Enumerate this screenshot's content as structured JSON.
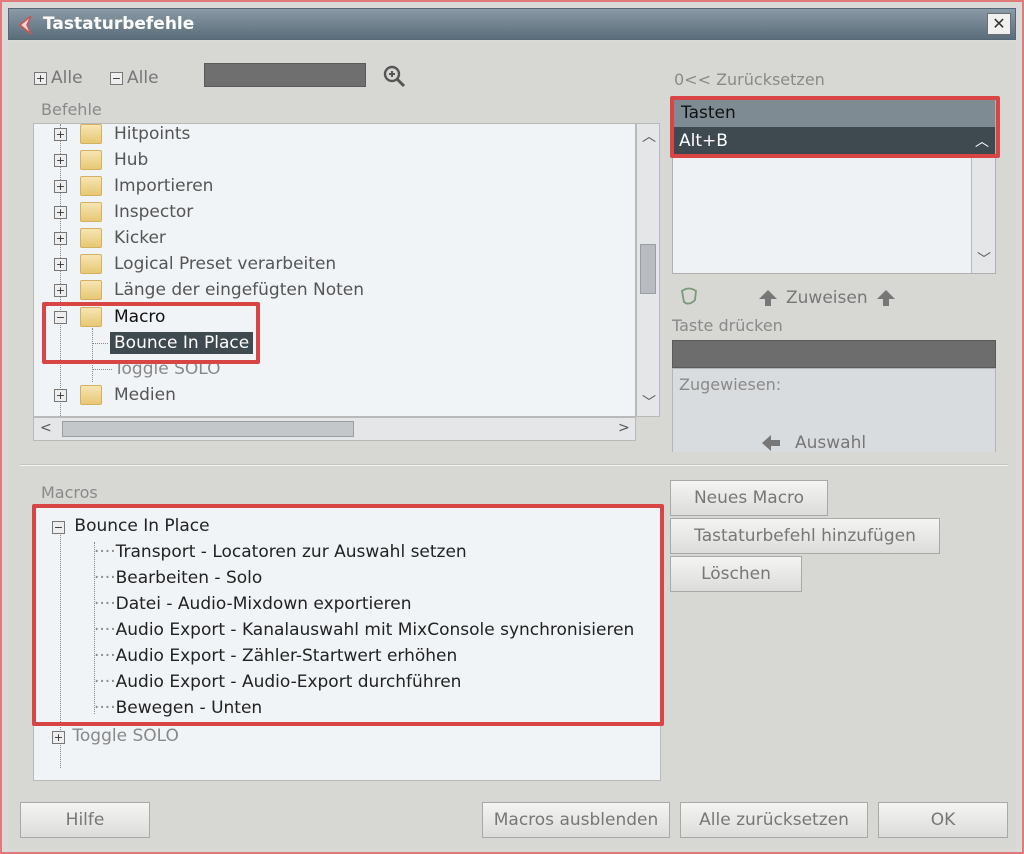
{
  "window": {
    "title": "Tastaturbefehle",
    "close_symbol": "✕"
  },
  "toolbar": {
    "expand_all": "Alle",
    "collapse_all": "Alle",
    "search_value": ""
  },
  "commands": {
    "label": "Befehle",
    "items": [
      {
        "label": "Hitpoints",
        "state": "collapsed"
      },
      {
        "label": "Hub",
        "state": "collapsed"
      },
      {
        "label": "Importieren",
        "state": "collapsed"
      },
      {
        "label": "Inspector",
        "state": "collapsed"
      },
      {
        "label": "Kicker",
        "state": "collapsed"
      },
      {
        "label": "Logical Preset verarbeiten",
        "state": "collapsed"
      },
      {
        "label": "Länge der eingefügten Noten",
        "state": "collapsed"
      },
      {
        "label": "Macro",
        "state": "expanded"
      },
      {
        "label": "Bounce In Place",
        "state": "selected-child"
      },
      {
        "label": "Toggle SOLO",
        "state": "child"
      },
      {
        "label": "Medien",
        "state": "collapsed"
      }
    ]
  },
  "keys": {
    "reset_label": "0<< Zurücksetzen",
    "header": "Tasten",
    "selected_key": "Alt+B",
    "assign_label": "Zuweisen",
    "press_key_label": "Taste drücken",
    "assigned_label": "Zugewiesen:",
    "selection_label": "Auswahl"
  },
  "macros": {
    "label": "Macros",
    "root": "Bounce In Place",
    "steps": [
      "Transport - Locatoren zur Auswahl setzen",
      "Bearbeiten - Solo",
      "Datei - Audio-Mixdown exportieren",
      "Audio Export - Kanalauswahl mit MixConsole synchronisieren",
      "Audio Export - Zähler-Startwert erhöhen",
      "Audio Export - Audio-Export durchführen",
      "Bewegen - Unten"
    ],
    "other": "Toggle SOLO",
    "new_macro": "Neues Macro",
    "add_command": "Tastaturbefehl hinzufügen",
    "delete": "Löschen"
  },
  "footer": {
    "help": "Hilfe",
    "hide_macros": "Macros ausblenden",
    "reset_all": "Alle zurücksetzen",
    "ok": "OK"
  },
  "colors": {
    "highlight": "#d94545",
    "selected_row": "#3f4950",
    "title_bar": "#5b6d7a"
  }
}
